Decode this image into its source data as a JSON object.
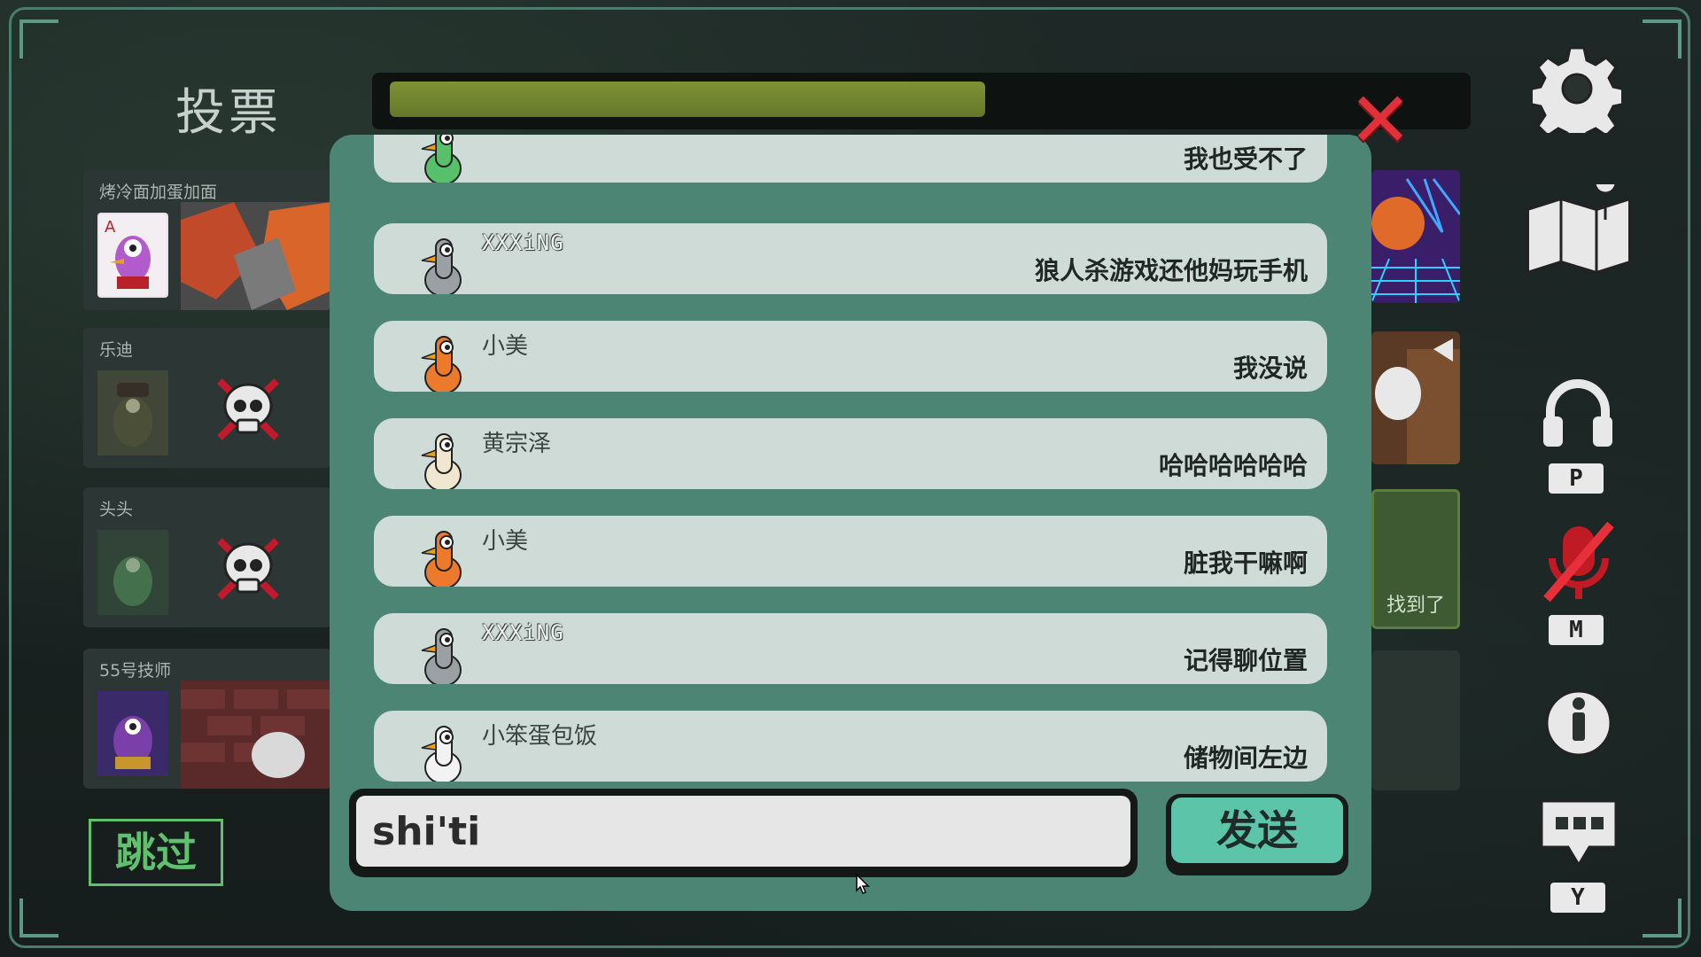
{
  "header": {
    "title": "投票",
    "timer_progress": 0.56
  },
  "players": [
    {
      "name": "烤冷面加蛋加面",
      "dead": false,
      "avatar_color": "#b25bcc"
    },
    {
      "name": "乐迪",
      "dead": true,
      "avatar_color": "#6a5a3a"
    },
    {
      "name": "头头",
      "dead": true,
      "avatar_color": "#4f8a55"
    },
    {
      "name": "55号技师",
      "dead": false,
      "avatar_color": "#7a3fa8"
    }
  ],
  "right_cards": {
    "found_label": "找到了"
  },
  "chat": {
    "messages": [
      {
        "name": "",
        "text": "我也受不了",
        "goose_color": "#58c06a"
      },
      {
        "name": "XXXiNG",
        "text": "狼人杀游戏还他妈玩手机",
        "goose_color": "#9aa0a3"
      },
      {
        "name": "小美",
        "text": "我没说",
        "goose_color": "#ec7a2c"
      },
      {
        "name": "黄宗泽",
        "text": "哈哈哈哈哈哈",
        "goose_color": "#f1e6cf"
      },
      {
        "name": "小美",
        "text": "脏我干嘛啊",
        "goose_color": "#ec7a2c"
      },
      {
        "name": "XXXiNG",
        "text": "记得聊位置",
        "goose_color": "#9aa0a3"
      },
      {
        "name": "小笨蛋包饭",
        "text": "储物间左边",
        "goose_color": "#f2f2f2"
      }
    ],
    "input_value": "shi'ti",
    "send_label": "发送"
  },
  "skip_label": "跳过",
  "side_icons": [
    {
      "icon": "gear-icon",
      "key": ""
    },
    {
      "icon": "map-icon",
      "key": ""
    },
    {
      "icon": "headphones-icon",
      "key": "P"
    },
    {
      "icon": "mic-muted-icon",
      "key": "M"
    },
    {
      "icon": "info-icon",
      "key": ""
    },
    {
      "icon": "chat-icon",
      "key": "Y"
    }
  ],
  "colors": {
    "panel": "#4c8574",
    "bubble": "#cfdbd7",
    "accent": "#5cc4a8",
    "danger": "#e0313a"
  }
}
